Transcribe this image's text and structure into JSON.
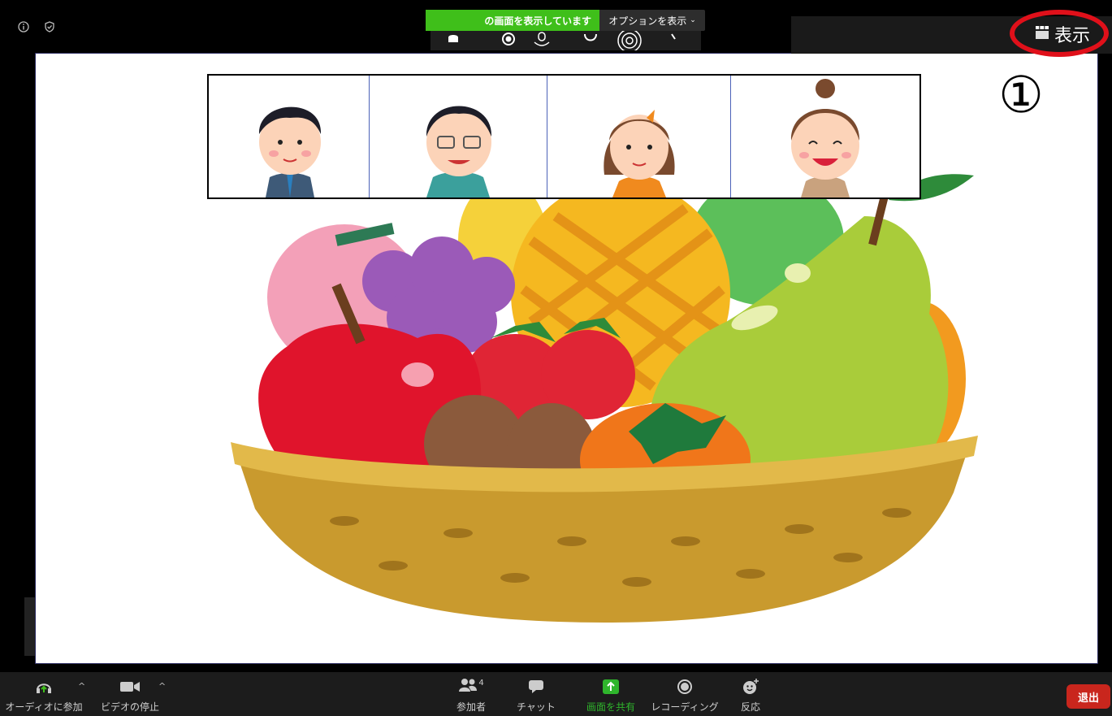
{
  "share_banner": {
    "status_text": "の画面を表示しています",
    "options_label": "オプションを表示",
    "status_color": "#3fbf1a"
  },
  "view_button": {
    "label": "表示",
    "icon": "view-grid-icon",
    "highlight_color": "#e0101a"
  },
  "annotation": {
    "step_marker": "①"
  },
  "top_icons": [
    "info-icon",
    "shield-icon"
  ],
  "gallery": {
    "participants": [
      {
        "icon": "avatar-man-suit"
      },
      {
        "icon": "avatar-man-glasses"
      },
      {
        "icon": "avatar-woman-hairclip"
      },
      {
        "icon": "avatar-woman-bun"
      }
    ]
  },
  "shared_content": {
    "image": "fruit-basket-illustration"
  },
  "toolbar": {
    "audio_label": "オーディオに参加",
    "video_label": "ビデオの停止",
    "participants_label": "参加者",
    "participants_count": "4",
    "chat_label": "チャット",
    "share_label": "画面を共有",
    "record_label": "レコーディング",
    "reactions_label": "反応",
    "leave_label": "退出",
    "share_color": "#2fb52c",
    "leave_color": "#c9261d"
  }
}
